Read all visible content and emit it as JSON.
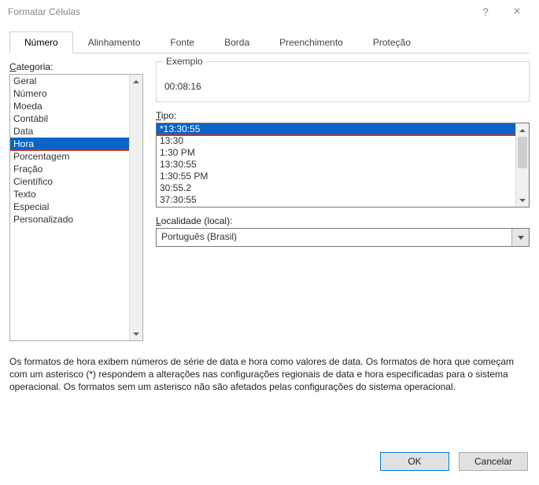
{
  "window": {
    "title": "Formatar Células",
    "help": "?",
    "close": "×"
  },
  "tabs": {
    "items": [
      {
        "label": "Número",
        "active": true
      },
      {
        "label": "Alinhamento",
        "active": false
      },
      {
        "label": "Fonte",
        "active": false
      },
      {
        "label": "Borda",
        "active": false
      },
      {
        "label": "Preenchimento",
        "active": false
      },
      {
        "label": "Proteção",
        "active": false
      }
    ]
  },
  "category": {
    "label_pre": "C",
    "label_post": "ategoria:",
    "items": [
      {
        "label": "Geral",
        "selected": false
      },
      {
        "label": "Número",
        "selected": false
      },
      {
        "label": "Moeda",
        "selected": false
      },
      {
        "label": "Contábil",
        "selected": false
      },
      {
        "label": "Data",
        "selected": false
      },
      {
        "label": "Hora",
        "selected": true,
        "red": true
      },
      {
        "label": "Porcentagem",
        "selected": false
      },
      {
        "label": "Fração",
        "selected": false
      },
      {
        "label": "Científico",
        "selected": false
      },
      {
        "label": "Texto",
        "selected": false
      },
      {
        "label": "Especial",
        "selected": false
      },
      {
        "label": "Personalizado",
        "selected": false
      }
    ]
  },
  "example": {
    "legend": "Exemplo",
    "value": "00:08:16"
  },
  "type": {
    "label_pre": "T",
    "label_post": "ipo:",
    "items": [
      {
        "label": "*13:30:55",
        "selected": true,
        "red": true
      },
      {
        "label": "13:30",
        "selected": false
      },
      {
        "label": "1:30 PM",
        "selected": false
      },
      {
        "label": "13:30:55",
        "selected": false
      },
      {
        "label": "1:30:55 PM",
        "selected": false
      },
      {
        "label": "30:55.2",
        "selected": false
      },
      {
        "label": "37:30:55",
        "selected": false
      }
    ]
  },
  "locale": {
    "label_pre": "L",
    "label_post": "ocalidade (local):",
    "value": "Português (Brasil)"
  },
  "description": "Os formatos de hora exibem números de série de data e hora como valores de data. Os formatos de hora que começam com um asterisco (*) respondem a alterações nas configurações regionais de data e hora especificadas para o sistema operacional. Os formatos sem um asterisco não são afetados pelas configurações do sistema operacional.",
  "buttons": {
    "ok": "OK",
    "cancel": "Cancelar"
  }
}
